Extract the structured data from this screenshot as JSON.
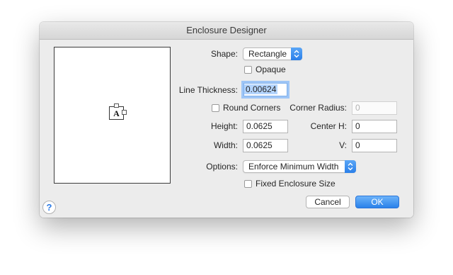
{
  "window": {
    "title": "Enclosure Designer"
  },
  "shape": {
    "label": "Shape:",
    "value": "Rectangle"
  },
  "opaque": {
    "label": "Opaque",
    "checked": false
  },
  "line_thickness": {
    "label": "Line Thickness:",
    "value": "0.00624"
  },
  "round_corners": {
    "label": "Round Corners",
    "checked": false
  },
  "corner_radius": {
    "label": "Corner Radius:",
    "value": "0"
  },
  "height": {
    "label": "Height:",
    "value": "0.0625"
  },
  "center_h": {
    "label": "Center H:",
    "value": "0"
  },
  "width": {
    "label": "Width:",
    "value": "0.0625"
  },
  "v": {
    "label": "V:",
    "value": "0"
  },
  "options": {
    "label": "Options:",
    "value": "Enforce Minimum Width"
  },
  "fixed_size": {
    "label": "Fixed Enclosure Size",
    "checked": false
  },
  "buttons": {
    "cancel": "Cancel",
    "ok": "OK",
    "help": "?"
  },
  "preview": {
    "symbol_letter": "A"
  },
  "colors": {
    "accent": "#2a81ea",
    "focus_ring": "#9fc6f6",
    "selection": "#b4d5fe"
  }
}
